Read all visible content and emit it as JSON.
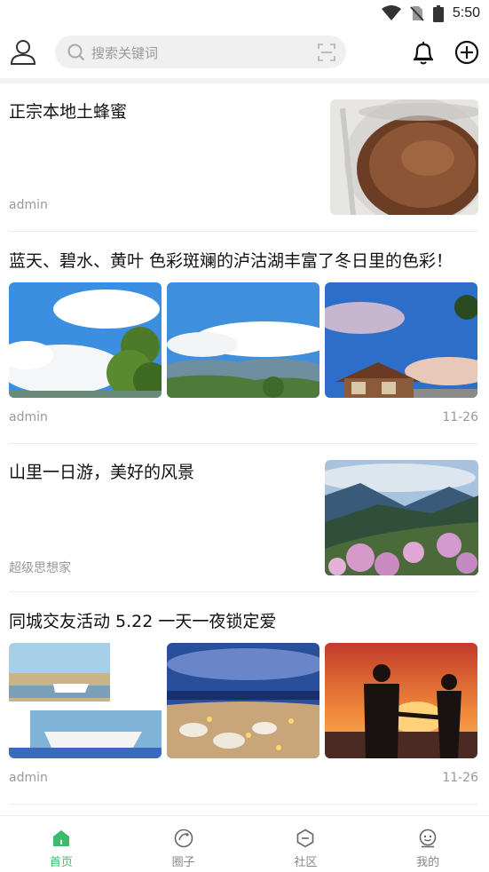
{
  "status_bar": {
    "time": "5:50"
  },
  "search": {
    "placeholder": "搜索关键词"
  },
  "feed": [
    {
      "title": "正宗本地土蜂蜜",
      "author": "admin",
      "date": ""
    },
    {
      "title": "蓝天、碧水、黄叶 色彩斑斓的泸沽湖丰富了冬日里的色彩！",
      "author": "admin",
      "date": "11-26"
    },
    {
      "title": "山里一日游，美好的风景",
      "author": "超级思想家",
      "date": ""
    },
    {
      "title": "同城交友活动 5.22 一天一夜锁定爱",
      "author": "admin",
      "date": "11-26"
    }
  ],
  "tabs": [
    {
      "label": "首页",
      "icon": "home-icon",
      "active": true
    },
    {
      "label": "圈子",
      "icon": "circle-icon",
      "active": false
    },
    {
      "label": "社区",
      "icon": "community-icon",
      "active": false
    },
    {
      "label": "我的",
      "icon": "profile-icon",
      "active": false
    }
  ],
  "colors": {
    "accent": "#3cbc6a",
    "meta_text": "#999999",
    "search_bg": "#f0f0f0"
  }
}
